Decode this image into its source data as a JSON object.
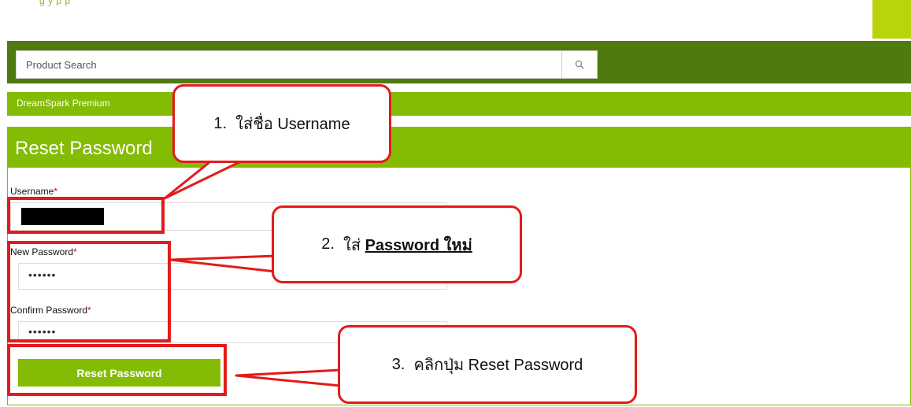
{
  "top_strip": {
    "text": "g   y  p   p"
  },
  "header": {
    "search_placeholder": "Product Search",
    "search_icon": "search-icon"
  },
  "nav": {
    "store_name": "DreamSpark Premium"
  },
  "form": {
    "title": "Reset Password",
    "username_label": "Username",
    "new_password_label": "New Password",
    "new_password_value": "••••••",
    "confirm_password_label": "Confirm Password",
    "confirm_password_value": "••••••",
    "required_marker": "*",
    "submit_label": "Reset Password"
  },
  "annotations": {
    "step1_number": "1.",
    "step1_text": "ใส่ชื่อ Username",
    "step2_number": "2.",
    "step2_text": "ใส่",
    "step2_emphasis": "Password ใหม่",
    "step3_number": "3.",
    "step3_text": "คลิกปุ่ม Reset Password"
  },
  "colors": {
    "header_green": "#4e7a0f",
    "accent_green": "#84bb04",
    "annotation_red": "#e31b1b"
  }
}
